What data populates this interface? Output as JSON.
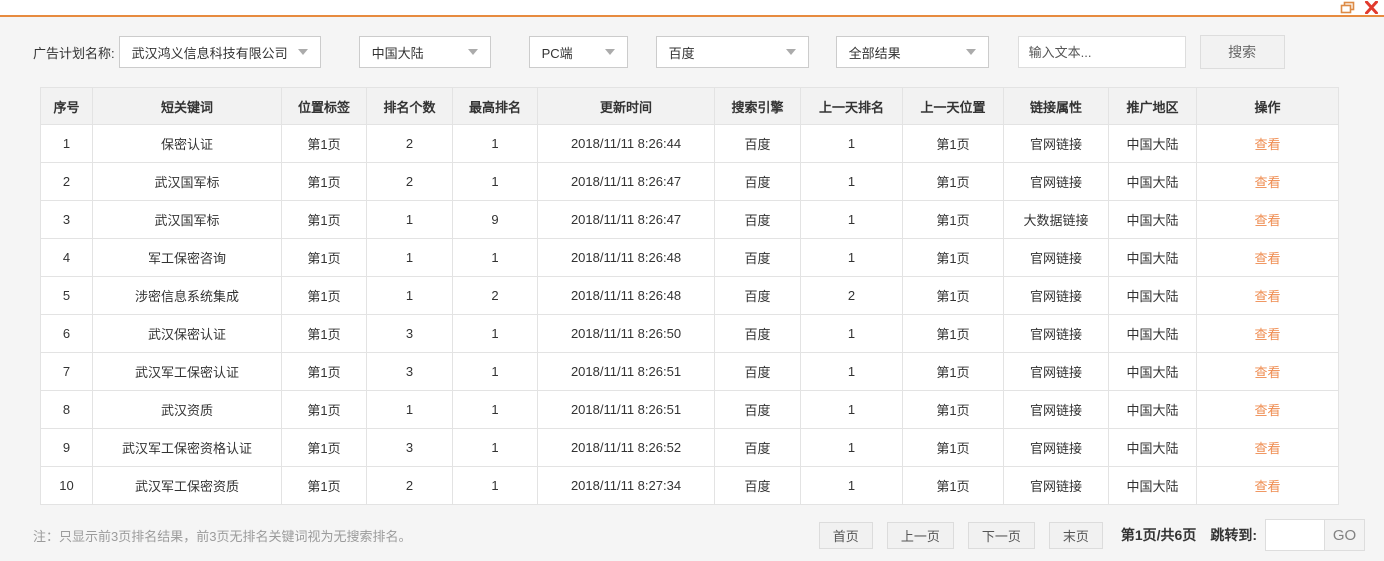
{
  "window": {
    "controls": {
      "restore": "restore-window",
      "close": "close-window"
    }
  },
  "colors": {
    "accent_orange": "#e78b3f",
    "link_orange": "#ef8c50",
    "close_red": "#e13b2e"
  },
  "filter_bar": {
    "label": "广告计划名称:",
    "dropdowns": [
      {
        "name": "campaign",
        "value": "武汉鸿义信息科技有限公司"
      },
      {
        "name": "region",
        "value": "中国大陆"
      },
      {
        "name": "platform",
        "value": "PC端"
      },
      {
        "name": "engine",
        "value": "百度"
      },
      {
        "name": "result-type",
        "value": "全部结果"
      }
    ],
    "search_input_placeholder": "输入文本...",
    "search_button": "搜索"
  },
  "table": {
    "columns": [
      "序号",
      "短关键词",
      "位置标签",
      "排名个数",
      "最高排名",
      "更新时间",
      "搜索引擎",
      "上一天排名",
      "上一天位置",
      "链接属性",
      "推广地区",
      "操作"
    ],
    "action_label": "查看",
    "rows": [
      [
        "1",
        "保密认证",
        "第1页",
        "2",
        "1",
        "2018/11/11 8:26:44",
        "百度",
        "1",
        "第1页",
        "官网链接",
        "中国大陆"
      ],
      [
        "2",
        "武汉国军标",
        "第1页",
        "2",
        "1",
        "2018/11/11 8:26:47",
        "百度",
        "1",
        "第1页",
        "官网链接",
        "中国大陆"
      ],
      [
        "3",
        "武汉国军标",
        "第1页",
        "1",
        "9",
        "2018/11/11 8:26:47",
        "百度",
        "1",
        "第1页",
        "大数据链接",
        "中国大陆"
      ],
      [
        "4",
        "军工保密咨询",
        "第1页",
        "1",
        "1",
        "2018/11/11 8:26:48",
        "百度",
        "1",
        "第1页",
        "官网链接",
        "中国大陆"
      ],
      [
        "5",
        "涉密信息系统集成",
        "第1页",
        "1",
        "2",
        "2018/11/11 8:26:48",
        "百度",
        "2",
        "第1页",
        "官网链接",
        "中国大陆"
      ],
      [
        "6",
        "武汉保密认证",
        "第1页",
        "3",
        "1",
        "2018/11/11 8:26:50",
        "百度",
        "1",
        "第1页",
        "官网链接",
        "中国大陆"
      ],
      [
        "7",
        "武汉军工保密认证",
        "第1页",
        "3",
        "1",
        "2018/11/11 8:26:51",
        "百度",
        "1",
        "第1页",
        "官网链接",
        "中国大陆"
      ],
      [
        "8",
        "武汉资质",
        "第1页",
        "1",
        "1",
        "2018/11/11 8:26:51",
        "百度",
        "1",
        "第1页",
        "官网链接",
        "中国大陆"
      ],
      [
        "9",
        "武汉军工保密资格认证",
        "第1页",
        "3",
        "1",
        "2018/11/11 8:26:52",
        "百度",
        "1",
        "第1页",
        "官网链接",
        "中国大陆"
      ],
      [
        "10",
        "武汉军工保密资质",
        "第1页",
        "2",
        "1",
        "2018/11/11 8:27:34",
        "百度",
        "1",
        "第1页",
        "官网链接",
        "中国大陆"
      ]
    ]
  },
  "footer": {
    "note": "注：只显示前3页排名结果，前3页无排名关键词视为无搜索排名。",
    "pagination": {
      "first": "首页",
      "prev": "上一页",
      "next": "下一页",
      "last": "末页",
      "page_info": "第1页/共6页",
      "jump_label": "跳转到:",
      "go": "GO"
    }
  }
}
